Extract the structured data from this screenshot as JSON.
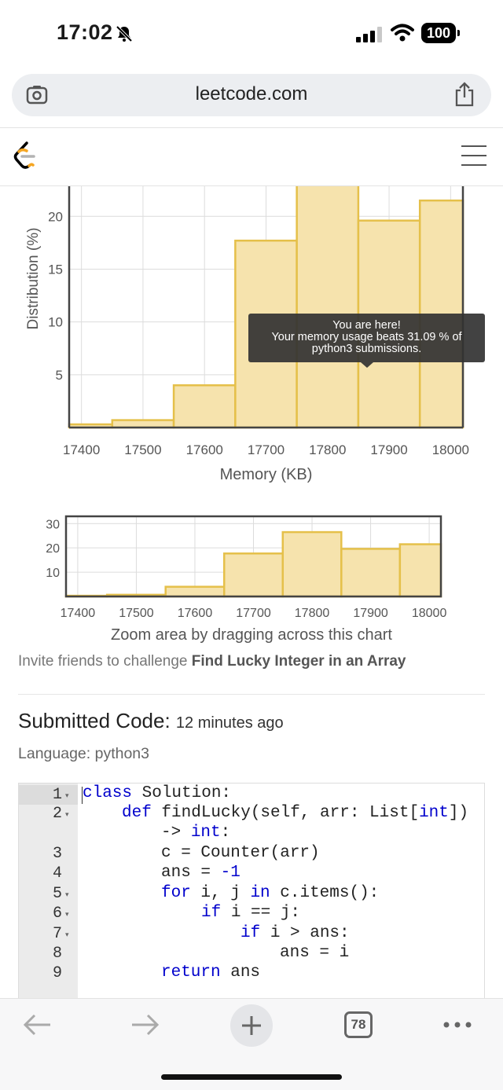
{
  "status_bar": {
    "time": "17:02",
    "battery": "100"
  },
  "browser": {
    "url": "leetcode.com",
    "tab_count": "78"
  },
  "chart_data": [
    {
      "type": "bar",
      "xlabel": "Memory (KB)",
      "ylabel": "Distribution (%)",
      "x_ticks": [
        "17400",
        "17500",
        "17600",
        "17700",
        "17800",
        "17900",
        "18000"
      ],
      "y_ticks": [
        "5",
        "10",
        "15",
        "20"
      ],
      "bins": [
        {
          "from": 17350,
          "to": 17450,
          "value": 0.3
        },
        {
          "from": 17450,
          "to": 17550,
          "value": 0.7
        },
        {
          "from": 17550,
          "to": 17650,
          "value": 4.0
        },
        {
          "from": 17650,
          "to": 17750,
          "value": 17.7
        },
        {
          "from": 17750,
          "to": 17850,
          "value": 26.5
        },
        {
          "from": 17850,
          "to": 17950,
          "value": 19.6
        },
        {
          "from": 17950,
          "to": 18050,
          "value": 21.5
        }
      ],
      "xlim": [
        17380,
        18020
      ],
      "ylim": [
        0,
        23
      ],
      "grid": true,
      "tooltip": {
        "line1": "You are here!",
        "line2": "Your memory usage beats 31.09 % of",
        "line3": "python3 submissions."
      }
    },
    {
      "type": "bar",
      "x_ticks": [
        "17400",
        "17500",
        "17600",
        "17700",
        "17800",
        "17900",
        "18000"
      ],
      "y_ticks": [
        "10",
        "20",
        "30"
      ],
      "bins": [
        {
          "from": 17350,
          "to": 17450,
          "value": 0.3
        },
        {
          "from": 17450,
          "to": 17550,
          "value": 0.7
        },
        {
          "from": 17550,
          "to": 17650,
          "value": 4.0
        },
        {
          "from": 17650,
          "to": 17750,
          "value": 17.7
        },
        {
          "from": 17750,
          "to": 17850,
          "value": 26.5
        },
        {
          "from": 17850,
          "to": 17950,
          "value": 19.6
        },
        {
          "from": 17950,
          "to": 18050,
          "value": 21.5
        }
      ],
      "xlim": [
        17380,
        18020
      ],
      "ylim": [
        0,
        33
      ],
      "grid": true
    }
  ],
  "zoom_hint": "Zoom area by dragging across this chart",
  "invite": {
    "prefix": "Invite friends to challenge ",
    "problem": "Find Lucky Integer in an Array"
  },
  "submission": {
    "heading": "Submitted Code:",
    "time_ago": "12 minutes ago",
    "language": "Language: python3"
  },
  "code": {
    "lines": [
      {
        "no": "1",
        "fold": true
      },
      {
        "no": "2",
        "fold": true
      },
      {
        "no": "3",
        "fold": false
      },
      {
        "no": "4",
        "fold": false
      },
      {
        "no": "5",
        "fold": true
      },
      {
        "no": "6",
        "fold": true
      },
      {
        "no": "7",
        "fold": true
      },
      {
        "no": "8",
        "fold": false
      },
      {
        "no": "9",
        "fold": false
      }
    ],
    "tokens": {
      "l1_kw": "class",
      "l1_rest": " Solution:",
      "l2_kw": "def",
      "l2_rest": " findLucky(self, arr: List[",
      "l2_type": "int",
      "l2_end": "])",
      "l2b_arrow": "->",
      "l2b_type": " int",
      "l2b_end": ":",
      "l3": "c = Counter(arr)",
      "l4_a": "ans = ",
      "l4_num": "-1",
      "l5_kw": "for",
      "l5_mid": " i, j ",
      "l5_in": "in",
      "l5_rest": " c.items():",
      "l6_kw": "if",
      "l6_rest": " i == j:",
      "l7_kw": "if",
      "l7_rest": " i > ans:",
      "l8": "ans = i",
      "l9_kw": "return",
      "l9_rest": " ans"
    }
  },
  "colors": {
    "bar_fill": "#f6e3ad",
    "bar_stroke": "#e5c04a",
    "keyword": "#0000cc"
  }
}
